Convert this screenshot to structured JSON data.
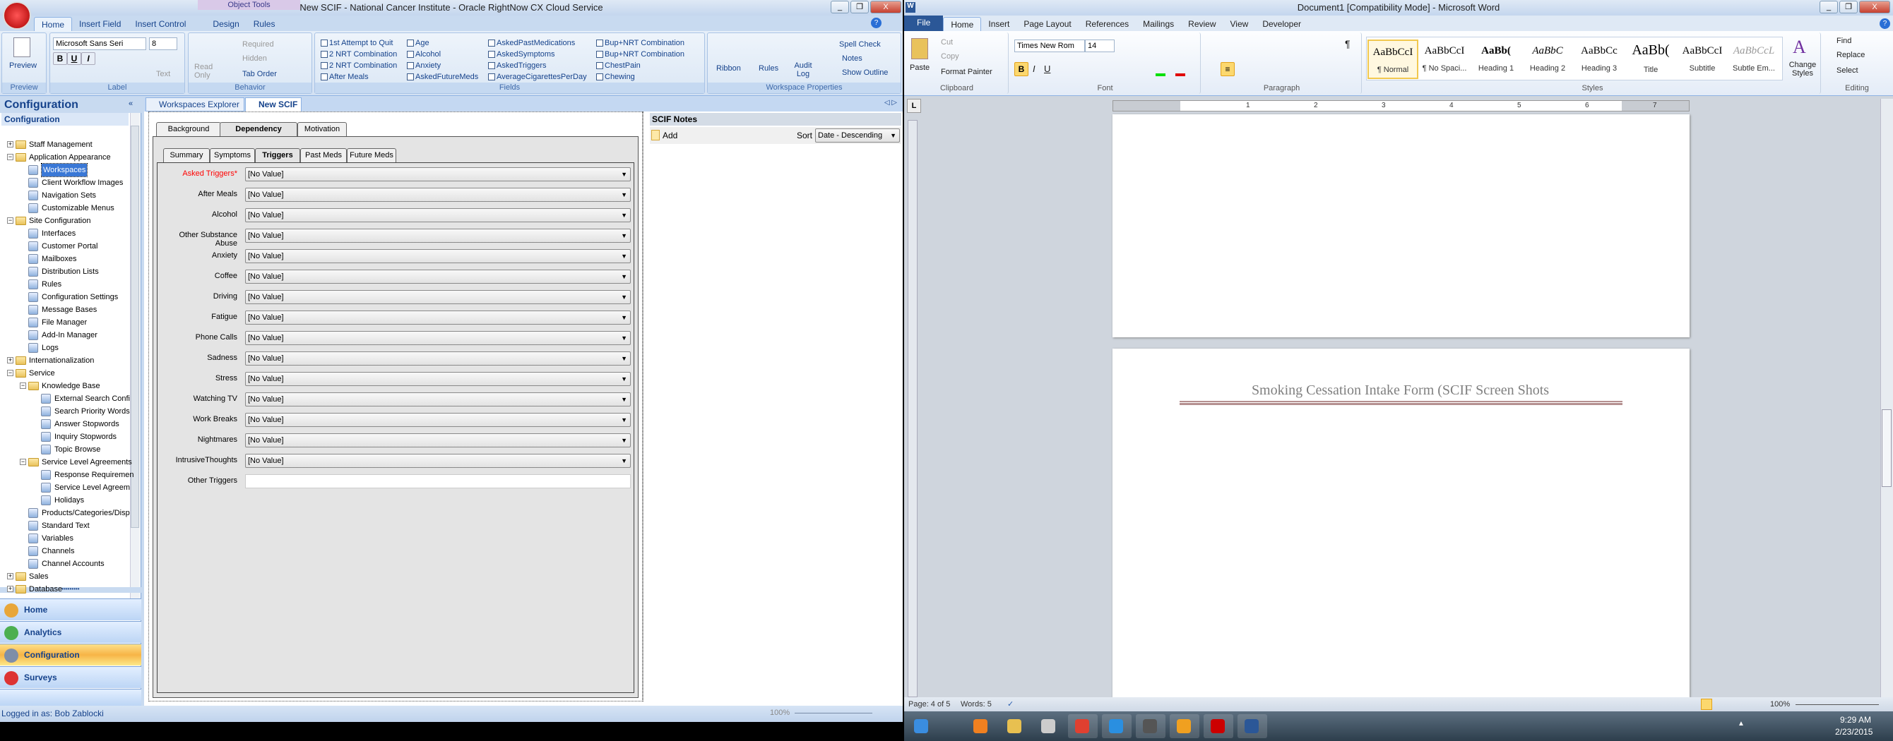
{
  "rnt": {
    "title": "New SCIF  - National Cancer Institute - Oracle RightNow CX Cloud Service",
    "context_tab": "Object Tools",
    "tabs": [
      "Home",
      "Insert Field",
      "Insert Control",
      "Design",
      "Rules"
    ],
    "active_tab": "Home",
    "ribbon": {
      "preview": {
        "label": "Preview",
        "group": "Preview"
      },
      "label_group": {
        "font": "Microsoft Sans Seri",
        "size": "8",
        "bold": "B",
        "underline": "U",
        "italic": "I",
        "text_btn": "Text",
        "group": "Label"
      },
      "behavior": {
        "read_only": "Read Only",
        "required": "Required",
        "hidden": "Hidden",
        "tab_order": "Tab Order",
        "group": "Behavior"
      },
      "fields": {
        "group": "Fields",
        "items": [
          [
            "1st Attempt to Quit",
            "2 NRT Combination",
            "2 NRT Combination",
            "After Meals"
          ],
          [
            "Age",
            "Alcohol",
            "Anxiety",
            "AskedFutureMeds"
          ],
          [
            "AskedPastMedications",
            "AskedSymptoms",
            "AskedTriggers",
            "AverageCigarettesPerDay"
          ],
          [
            "Bup+NRT Combination",
            "Bup+NRT Combination",
            "ChestPain",
            "Chewing"
          ]
        ]
      },
      "workspace": {
        "ribbon": "Ribbon",
        "rules": "Rules",
        "audit_log": "Audit Log",
        "spell_check": "Spell Check",
        "notes": "Notes",
        "show_outline": "Show Outline",
        "group": "Workspace Properties"
      }
    },
    "sidebar": {
      "title": "Configuration",
      "section": "Configuration",
      "tree": [
        {
          "label": "Staff Management",
          "level": 0,
          "folder": true,
          "state": "+"
        },
        {
          "label": "Application Appearance",
          "level": 0,
          "folder": true,
          "state": "-"
        },
        {
          "label": "Workspaces",
          "level": 1,
          "selected": true
        },
        {
          "label": "Client Workflow Images",
          "level": 1
        },
        {
          "label": "Navigation Sets",
          "level": 1
        },
        {
          "label": "Customizable Menus",
          "level": 1
        },
        {
          "label": "Site Configuration",
          "level": 0,
          "folder": true,
          "state": "-"
        },
        {
          "label": "Interfaces",
          "level": 1
        },
        {
          "label": "Customer Portal",
          "level": 1
        },
        {
          "label": "Mailboxes",
          "level": 1
        },
        {
          "label": "Distribution Lists",
          "level": 1
        },
        {
          "label": "Rules",
          "level": 1
        },
        {
          "label": "Configuration Settings",
          "level": 1
        },
        {
          "label": "Message Bases",
          "level": 1
        },
        {
          "label": "File Manager",
          "level": 1
        },
        {
          "label": "Add-In Manager",
          "level": 1
        },
        {
          "label": "Logs",
          "level": 1
        },
        {
          "label": "Internationalization",
          "level": 0,
          "folder": true,
          "state": "+"
        },
        {
          "label": "Service",
          "level": 0,
          "folder": true,
          "state": "-"
        },
        {
          "label": "Knowledge Base",
          "level": 1,
          "folder": true,
          "state": "-"
        },
        {
          "label": "External Search Confi",
          "level": 2
        },
        {
          "label": "Search Priority Words",
          "level": 2
        },
        {
          "label": "Answer Stopwords",
          "level": 2
        },
        {
          "label": "Inquiry Stopwords",
          "level": 2
        },
        {
          "label": "Topic Browse",
          "level": 2
        },
        {
          "label": "Service Level Agreements",
          "level": 1,
          "folder": true,
          "state": "-"
        },
        {
          "label": "Response Requiremen",
          "level": 2
        },
        {
          "label": "Service Level Agreem",
          "level": 2
        },
        {
          "label": "Holidays",
          "level": 2
        },
        {
          "label": "Products/Categories/Disp",
          "level": 1
        },
        {
          "label": "Standard Text",
          "level": 1
        },
        {
          "label": "Variables",
          "level": 1
        },
        {
          "label": "Channels",
          "level": 1
        },
        {
          "label": "Channel Accounts",
          "level": 1
        },
        {
          "label": "Sales",
          "level": 0,
          "folder": true,
          "state": "+"
        },
        {
          "label": "Database",
          "level": 0,
          "folder": true,
          "state": "+"
        }
      ],
      "nav": [
        {
          "label": "Home",
          "color": "#e8a63a"
        },
        {
          "label": "Analytics",
          "color": "#4caf50"
        },
        {
          "label": "Configuration",
          "color": "#7f8ea8",
          "active": true
        },
        {
          "label": "Surveys",
          "color": "#d33"
        }
      ]
    },
    "status": {
      "logged_in": "Logged in as: Bob Zablocki",
      "zoom": "100%"
    },
    "content_tabs": [
      "Workspaces Explorer",
      "New SCIF"
    ],
    "form": {
      "tabs": [
        "Background",
        "Dependency",
        "Motivation"
      ],
      "active_tab": "Dependency",
      "subtabs": [
        "Summary",
        "Symptoms",
        "Triggers",
        "Past Meds",
        "Future Meds"
      ],
      "active_subtab": "Triggers",
      "rows": [
        {
          "label": "Asked Triggers*",
          "value": "[No Value]",
          "required": true
        },
        {
          "label": "After Meals",
          "value": "[No Value]"
        },
        {
          "label": "Alcohol",
          "value": "[No Value]"
        },
        {
          "label": "Other Substance Abuse",
          "value": "[No Value]"
        },
        {
          "label": "Anxiety",
          "value": "[No Value]"
        },
        {
          "label": "Coffee",
          "value": "[No Value]"
        },
        {
          "label": "Driving",
          "value": "[No Value]"
        },
        {
          "label": "Fatigue",
          "value": "[No Value]"
        },
        {
          "label": "Phone Calls",
          "value": "[No Value]"
        },
        {
          "label": "Sadness",
          "value": "[No Value]"
        },
        {
          "label": "Stress",
          "value": "[No Value]"
        },
        {
          "label": "Watching TV",
          "value": "[No Value]"
        },
        {
          "label": "Work Breaks",
          "value": "[No Value]"
        },
        {
          "label": "Nightmares",
          "value": "[No Value]"
        },
        {
          "label": "IntrusiveThoughts",
          "value": "[No Value]"
        },
        {
          "label": "Other Triggers",
          "value": "",
          "text": true
        }
      ],
      "required_color": "#ff0000"
    },
    "notes": {
      "title": "SCIF Notes",
      "add": "Add",
      "sort_label": "Sort",
      "sort_value": "Date - Descending"
    }
  },
  "word": {
    "title": "Document1 [Compatibility Mode] - Microsoft Word",
    "tabs": [
      "File",
      "Home",
      "Insert",
      "Page Layout",
      "References",
      "Mailings",
      "Review",
      "View",
      "Developer"
    ],
    "active_tab": "Home",
    "clipboard": {
      "paste": "Paste",
      "cut": "Cut",
      "copy": "Copy",
      "format_painter": "Format Painter",
      "group": "Clipboard"
    },
    "font": {
      "name": "Times New Rom",
      "size": "14",
      "group": "Font"
    },
    "paragraph": {
      "group": "Paragraph"
    },
    "styles": {
      "group": "Styles",
      "change": "Change Styles",
      "items": [
        {
          "sample": "AaBbCcI",
          "name": "¶ Normal",
          "active": true
        },
        {
          "sample": "AaBbCcI",
          "name": "¶ No Spaci..."
        },
        {
          "sample": "AaBb(",
          "name": "Heading 1",
          "bold": true
        },
        {
          "sample": "AaBbC",
          "name": "Heading 2",
          "italic": true
        },
        {
          "sample": "AaBbCc",
          "name": "Heading 3"
        },
        {
          "sample": "AaBb(",
          "name": "Title",
          "big": true
        },
        {
          "sample": "AaBbCcI",
          "name": "Subtitle"
        },
        {
          "sample": "AaBbCcL",
          "name": "Subtle Em...",
          "italic": true,
          "muted": true
        }
      ]
    },
    "editing": {
      "find": "Find",
      "replace": "Replace",
      "select": "Select",
      "group": "Editing"
    },
    "ruler_marks": [
      "1",
      "2",
      "3",
      "4",
      "5",
      "6",
      "7"
    ],
    "document": {
      "heading": "Smoking Cessation Intake Form (SCIF Screen Shots"
    },
    "status": {
      "page": "Page: 4 of 5",
      "words": "Words: 5",
      "zoom": "100%"
    }
  },
  "taskbar": {
    "time": "9:29 AM",
    "date": "2/23/2015",
    "icons": [
      "start-icon",
      "media-player-icon",
      "explorer-icon",
      "network-icon",
      "chrome-icon",
      "ie-icon",
      "pen-icon",
      "outlook-icon",
      "rightnow-icon",
      "word-icon"
    ]
  }
}
